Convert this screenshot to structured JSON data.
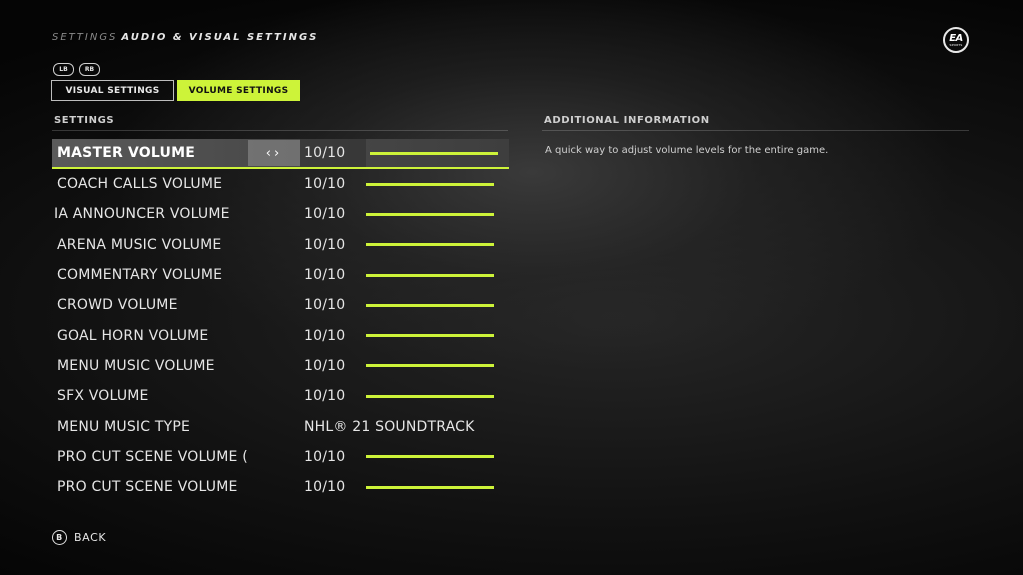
{
  "breadcrumb": {
    "root": "SETTINGS",
    "current": "AUDIO & VISUAL SETTINGS"
  },
  "logo": {
    "main": "EA",
    "sub": "SPORTS"
  },
  "bumpers": {
    "left": "LB",
    "right": "RB"
  },
  "tabs": [
    {
      "label": "VISUAL SETTINGS",
      "active": false
    },
    {
      "label": "VOLUME SETTINGS",
      "active": true
    }
  ],
  "sections": {
    "settings": "SETTINGS",
    "info": "ADDITIONAL INFORMATION"
  },
  "arrows": "‹›",
  "settings": [
    {
      "label": "MASTER VOLUME",
      "value": "10/10",
      "level": 1.0,
      "selected": true
    },
    {
      "label": "COACH CALLS VOLUME",
      "value": "10/10",
      "level": 1.0
    },
    {
      "label": "IA ANNOUNCER VOLUME      A",
      "value": "10/10",
      "level": 1.0
    },
    {
      "label": "ARENA MUSIC VOLUME",
      "value": "10/10",
      "level": 1.0
    },
    {
      "label": "COMMENTARY VOLUME",
      "value": "10/10",
      "level": 1.0
    },
    {
      "label": "CROWD VOLUME",
      "value": "10/10",
      "level": 1.0
    },
    {
      "label": "GOAL HORN VOLUME",
      "value": "10/10",
      "level": 1.0
    },
    {
      "label": "MENU MUSIC VOLUME",
      "value": "10/10",
      "level": 1.0
    },
    {
      "label": "SFX VOLUME",
      "value": "10/10",
      "level": 1.0
    },
    {
      "label": "MENU MUSIC TYPE",
      "value": "NHL® 21 SOUNDTRACK",
      "level": null
    },
    {
      "label": "PRO CUT SCENE VOLUME (IN-",
      "value": "10/10",
      "level": 1.0
    },
    {
      "label": "PRO CUT SCENE VOLUME",
      "value": "10/10",
      "level": 1.0
    }
  ],
  "info": {
    "text": "A quick way to adjust volume levels for the entire game."
  },
  "footer": {
    "back_button": "B",
    "back_label": "BACK"
  },
  "colors": {
    "accent": "#cdf339"
  }
}
